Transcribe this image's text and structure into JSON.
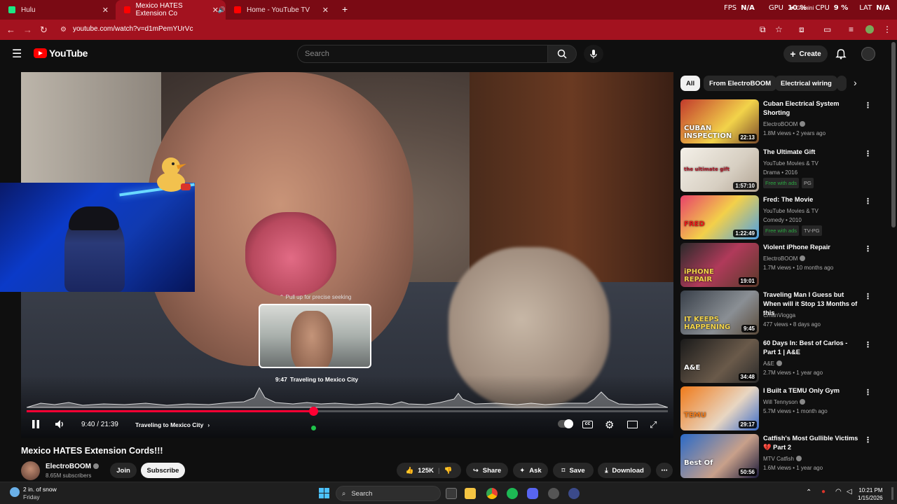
{
  "browser": {
    "tabs": [
      {
        "label": "Hulu"
      },
      {
        "label": "Mexico HATES Extension Co"
      },
      {
        "label": "Home - YouTube TV"
      }
    ],
    "new_tab": "+",
    "url": "youtube.com/watch?v=d1mPemYUrVc",
    "overlay": {
      "fps_label": "FPS",
      "fps": "N/A",
      "gpu_label": "GPU",
      "gpu": "10 %",
      "cpu_label": "CPU",
      "cpu": "9 %",
      "lat_label": "LAT",
      "lat": "N/A",
      "gemini": "Gemini"
    }
  },
  "youtube": {
    "logo": "YouTube",
    "search_placeholder": "Search",
    "create_label": "Create"
  },
  "player": {
    "seek_hint": "Pull up for precise seeking",
    "preview_time": "9:47",
    "preview_chapter": "Traveling to Mexico City",
    "time_display": "9:40 / 21:39",
    "chapter": "Traveling to Mexico City",
    "progress_fraction": 0.447
  },
  "video": {
    "title": "Mexico HATES Extension Cords!!!",
    "channel": "ElectroBOOM",
    "subscribers": "8.65M subscribers",
    "join": "Join",
    "subscribe": "Subscribe",
    "likes": "125K",
    "share": "Share",
    "ask": "Ask",
    "save": "Save",
    "download": "Download"
  },
  "sidebar": {
    "chips": [
      "All",
      "From ElectroBOOM",
      "Electrical wiring"
    ],
    "recs": [
      {
        "title": "Cuban Electrical System Shorting",
        "channel": "ElectroBOOM",
        "meta": "1.8M views • 2 years ago",
        "duration": "22:13",
        "thumb_text": "CUBAN INSPECTION"
      },
      {
        "title": "The Ultimate Gift",
        "channel": "YouTube Movies & TV",
        "meta": "Drama • 2016",
        "duration": "1:57:10",
        "badge1": "Free with ads",
        "badge2": "PG",
        "thumb_text": "the ultimate gift"
      },
      {
        "title": "Fred: The Movie",
        "channel": "YouTube Movies & TV",
        "meta": "Comedy • 2010",
        "duration": "1:22:49",
        "badge1": "Free with ads",
        "badge2": "TV-PG",
        "thumb_text": "FRED"
      },
      {
        "title": "Violent iPhone Repair",
        "channel": "ElectroBOOM",
        "meta": "1.7M views • 10 months ago",
        "duration": "19:01",
        "thumb_text": "iPHONE REPAIR"
      },
      {
        "title": "Traveling Man I Guess but When will it Stop 13 Months of this",
        "channel": "CmanViogga",
        "meta": "477 views • 8 days ago",
        "duration": "9:45",
        "thumb_text": "IT KEEPS HAPPENING"
      },
      {
        "title": "60 Days In: Best of Carlos - Part 1 | A&E",
        "channel": "A&E",
        "meta": "2.7M views • 1 year ago",
        "duration": "34:48",
        "thumb_text": "A&E"
      },
      {
        "title": "I Built a TEMU Only Gym",
        "channel": "Will Tennyson",
        "meta": "5.7M views • 1 month ago",
        "duration": "29:17",
        "thumb_text": "TEMU"
      },
      {
        "title": "Catfish's Most Gullible Victims 💔 Part 2",
        "channel": "MTV Catfish",
        "meta": "1.6M views • 1 year ago",
        "duration": "50:56",
        "thumb_text": "Best Of"
      }
    ]
  },
  "taskbar": {
    "weather": "2 in. of snow",
    "weather_day": "Friday",
    "search": "Search",
    "time": "10:21 PM",
    "date": "1/15/2026"
  }
}
